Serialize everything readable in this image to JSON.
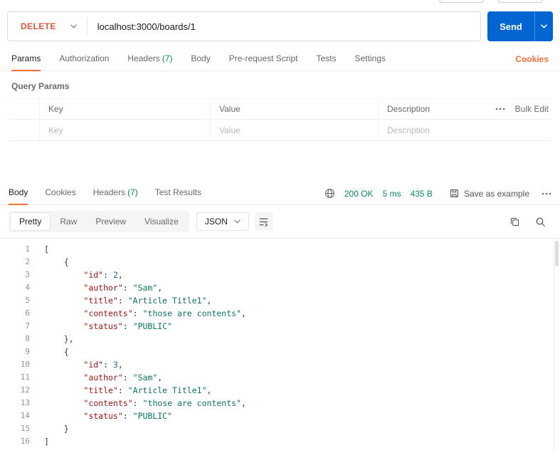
{
  "request": {
    "method": "DELETE",
    "url": "localhost:3000/boards/1",
    "send_label": "Send"
  },
  "request_tabs": {
    "params": "Params",
    "authorization": "Authorization",
    "headers": "Headers",
    "headers_count": "(7)",
    "body": "Body",
    "prerequest": "Pre-request Script",
    "tests": "Tests",
    "settings": "Settings",
    "cookies_link": "Cookies"
  },
  "query_params": {
    "section_title": "Query Params",
    "col_key": "Key",
    "col_value": "Value",
    "col_description": "Description",
    "bulk_edit_label": "Bulk Edit",
    "row_placeholder_key": "Key",
    "row_placeholder_value": "Value",
    "row_placeholder_description": "Description"
  },
  "response": {
    "tabs": {
      "body": "Body",
      "cookies": "Cookies",
      "headers": "Headers",
      "headers_count": "(7)",
      "test_results": "Test Results"
    },
    "status": "200 OK",
    "time": "5 ms",
    "size": "435 B",
    "save_as_example_label": "Save as example",
    "view_tabs": {
      "pretty": "Pretty",
      "raw": "Raw",
      "preview": "Preview",
      "visualize": "Visualize"
    },
    "format_select": "JSON"
  },
  "colors": {
    "accent_orange": "#FF6C37",
    "method_delete": "#E0563F",
    "send_button_blue": "#0265D2",
    "success_green": "#0B8A67",
    "json_key": "#A31515",
    "json_string": "#0B7763",
    "json_number": "#1C66B3"
  },
  "code_lines": [
    [
      [
        "p",
        "["
      ]
    ],
    [
      [
        "p",
        "    {"
      ]
    ],
    [
      [
        "p",
        "        "
      ],
      [
        "k",
        "\"id\""
      ],
      [
        "p",
        ": "
      ],
      [
        "n",
        "2"
      ],
      [
        "p",
        ","
      ]
    ],
    [
      [
        "p",
        "        "
      ],
      [
        "k",
        "\"author\""
      ],
      [
        "p",
        ": "
      ],
      [
        "s",
        "\"Sam\""
      ],
      [
        "p",
        ","
      ]
    ],
    [
      [
        "p",
        "        "
      ],
      [
        "k",
        "\"title\""
      ],
      [
        "p",
        ": "
      ],
      [
        "s",
        "\"Article Title1\""
      ],
      [
        "p",
        ","
      ]
    ],
    [
      [
        "p",
        "        "
      ],
      [
        "k",
        "\"contents\""
      ],
      [
        "p",
        ": "
      ],
      [
        "s",
        "\"those are contents\""
      ],
      [
        "p",
        ","
      ]
    ],
    [
      [
        "p",
        "        "
      ],
      [
        "k",
        "\"status\""
      ],
      [
        "p",
        ": "
      ],
      [
        "s",
        "\"PUBLIC\""
      ]
    ],
    [
      [
        "p",
        "    },"
      ]
    ],
    [
      [
        "p",
        "    {"
      ]
    ],
    [
      [
        "p",
        "        "
      ],
      [
        "k",
        "\"id\""
      ],
      [
        "p",
        ": "
      ],
      [
        "n",
        "3"
      ],
      [
        "p",
        ","
      ]
    ],
    [
      [
        "p",
        "        "
      ],
      [
        "k",
        "\"author\""
      ],
      [
        "p",
        ": "
      ],
      [
        "s",
        "\"Sam\""
      ],
      [
        "p",
        ","
      ]
    ],
    [
      [
        "p",
        "        "
      ],
      [
        "k",
        "\"title\""
      ],
      [
        "p",
        ": "
      ],
      [
        "s",
        "\"Article Title1\""
      ],
      [
        "p",
        ","
      ]
    ],
    [
      [
        "p",
        "        "
      ],
      [
        "k",
        "\"contents\""
      ],
      [
        "p",
        ": "
      ],
      [
        "s",
        "\"those are contents\""
      ],
      [
        "p",
        ","
      ]
    ],
    [
      [
        "p",
        "        "
      ],
      [
        "k",
        "\"status\""
      ],
      [
        "p",
        ": "
      ],
      [
        "s",
        "\"PUBLIC\""
      ]
    ],
    [
      [
        "p",
        "    }"
      ]
    ],
    [
      [
        "p",
        "]"
      ]
    ]
  ]
}
